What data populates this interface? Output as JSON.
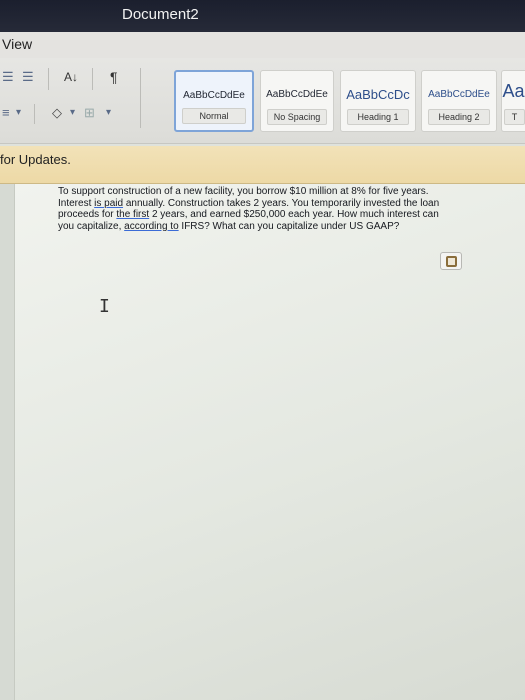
{
  "window": {
    "title": "Document2"
  },
  "menu": {
    "view_label": "View"
  },
  "ribbon": {
    "icons": {
      "list_indent_1": "☰",
      "list_indent_2": "☰",
      "sort": "A↓",
      "pilcrow": "¶",
      "align": "≡",
      "dropdown": "▾",
      "paint_bucket": "◇",
      "borders": "⊞"
    },
    "styles": [
      {
        "sample": "AaBbCcDdEe",
        "name": "Normal"
      },
      {
        "sample": "AaBbCcDdEe",
        "name": "No Spacing"
      },
      {
        "sample": "AaBbCcDc",
        "name": "Heading 1"
      },
      {
        "sample": "AaBbCcDdEe",
        "name": "Heading 2"
      },
      {
        "sample": "Aa",
        "name": "T"
      }
    ]
  },
  "notice": {
    "text": "for Updates."
  },
  "document": {
    "q1": "To support construction of a new facility, you borrow $10 million at 8% for five years.",
    "q2a": "Interest ",
    "q2b": "is  paid",
    "q2c": " annually. Construction takes 2 years. You temporarily invested the loan",
    "q3a": "proceeds for ",
    "q3b": "the  first",
    "q3c": " 2 years, and earned $250,000 each year. How much interest can",
    "q4a": "you capitalize, ",
    "q4b": "according  to",
    "q4c": " IFRS? What can you capitalize under US GAAP?"
  },
  "colors": {
    "titlebar": "#1b1f2e",
    "notice_bar": "#f2e2b8",
    "selected_style": "#7ea4d8",
    "underline": "#3b6bd6"
  }
}
